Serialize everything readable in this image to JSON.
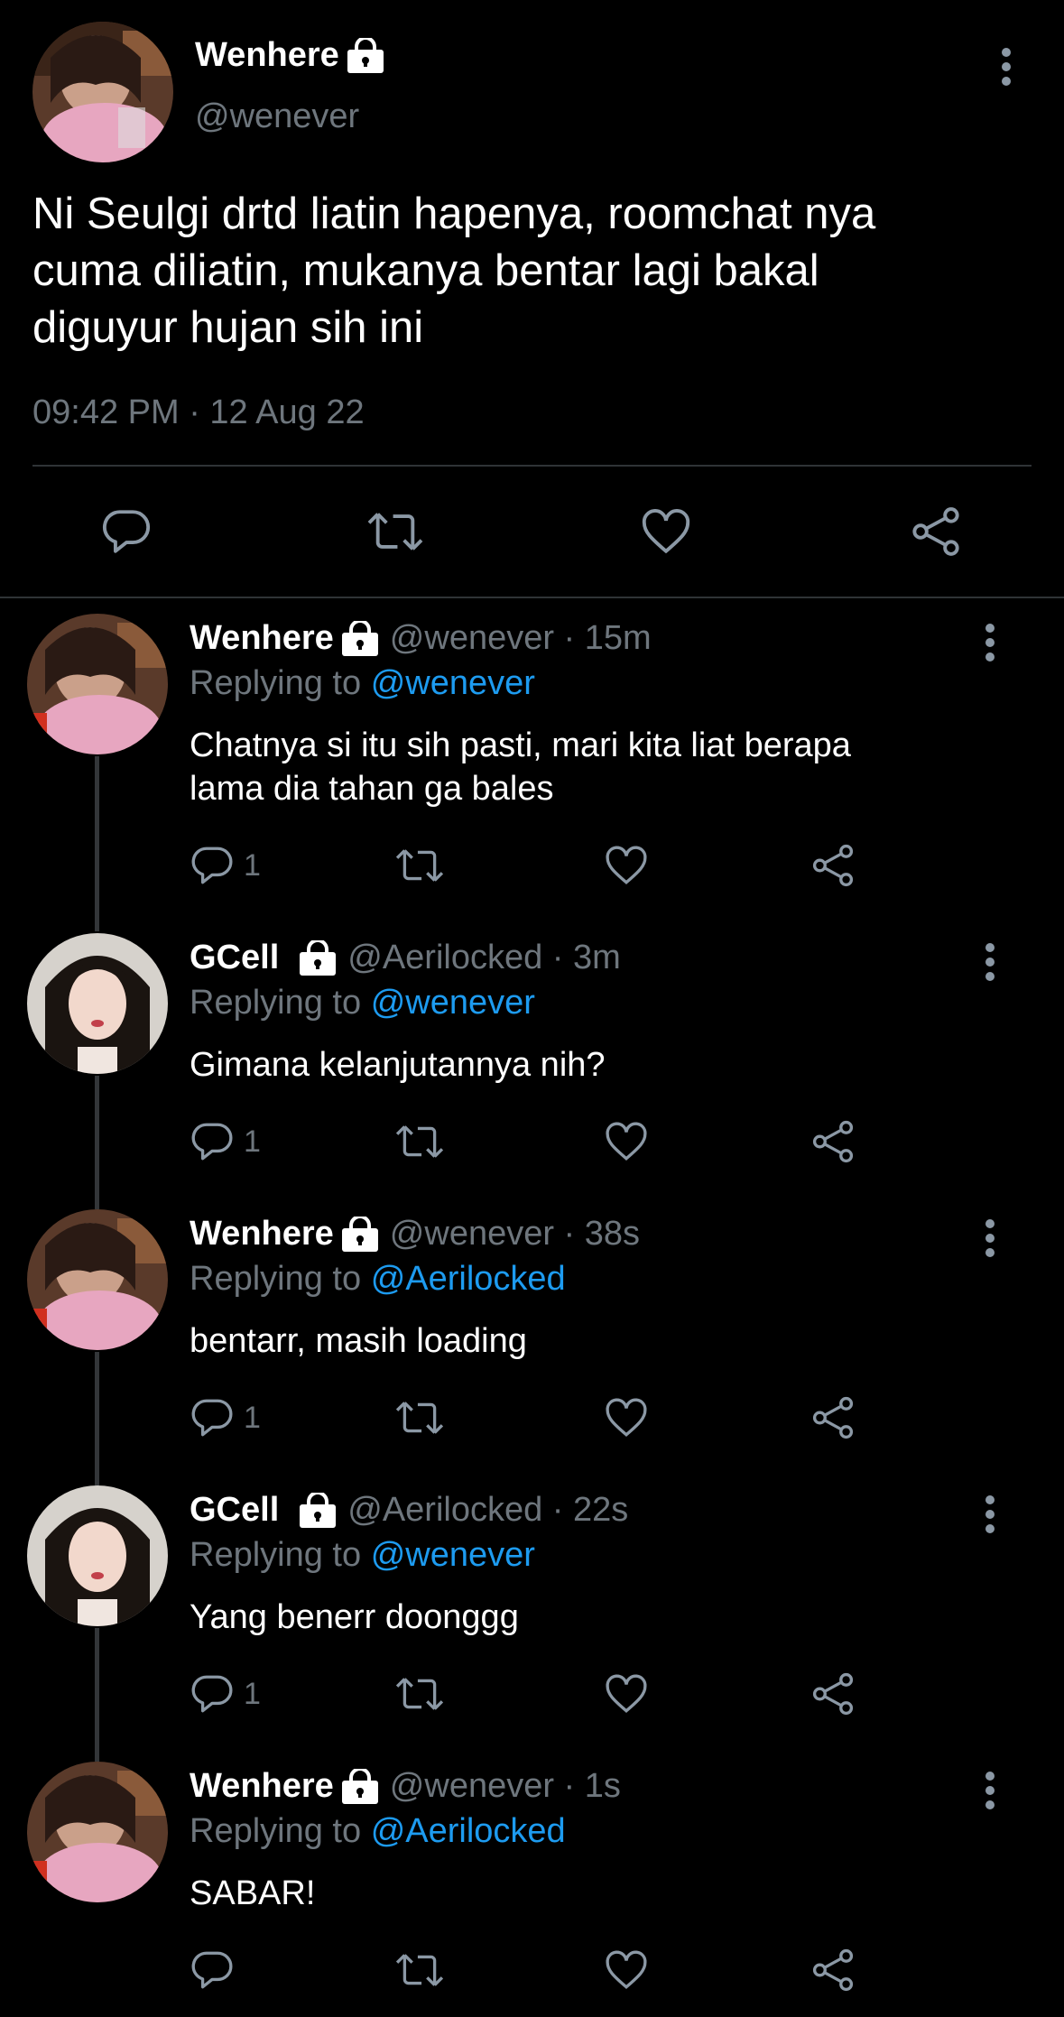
{
  "main_tweet": {
    "display_name": "Wenhere",
    "handle": "@wenever",
    "text_lines": [
      "Ni Seulgi drtd liatin hapenya, roomchat nya",
      "cuma diliatin, mukanya bentar lagi bakal",
      "diguyur hujan sih ini"
    ],
    "timestamp": "09:42 PM · 12 Aug 22"
  },
  "replies": [
    {
      "display_name": "Wenhere",
      "handle_time": "@wenever · 15m",
      "replying_prefix": "Replying to",
      "replying_to": "@wenever",
      "text_lines": [
        "Chatnya si itu sih pasti, mari kita liat berapa",
        "lama dia tahan ga bales"
      ],
      "reply_count": "1",
      "avatar": "wenhere"
    },
    {
      "display_name": "GCell",
      "handle_time": "@Aerilocked · 3m",
      "replying_prefix": "Replying to",
      "replying_to": "@wenever",
      "text_lines": [
        "Gimana kelanjutannya nih?"
      ],
      "reply_count": "1",
      "avatar": "gcell"
    },
    {
      "display_name": "Wenhere",
      "handle_time": "@wenever · 38s",
      "replying_prefix": "Replying to",
      "replying_to": "@Aerilocked",
      "text_lines": [
        "bentarr, masih loading"
      ],
      "reply_count": "1",
      "avatar": "wenhere"
    },
    {
      "display_name": "GCell",
      "handle_time": "@Aerilocked · 22s",
      "replying_prefix": "Replying to",
      "replying_to": "@wenever",
      "text_lines": [
        "Yang benerr doonggg"
      ],
      "reply_count": "1",
      "avatar": "gcell"
    },
    {
      "display_name": "Wenhere",
      "handle_time": "@wenever · 1s",
      "replying_prefix": "Replying to",
      "replying_to": "@Aerilocked",
      "text_lines": [
        "SABAR!"
      ],
      "reply_count": "",
      "avatar": "wenhere"
    }
  ],
  "icons": {
    "reply": "reply-icon",
    "retweet": "retweet-icon",
    "like": "like-icon",
    "share": "share-icon",
    "more": "more-icon",
    "lock": "lock-icon"
  },
  "colors": {
    "background": "#000000",
    "text": "#e7e9ea",
    "muted": "#6e767d",
    "link": "#1d9bf0",
    "divider": "#2f3336"
  }
}
